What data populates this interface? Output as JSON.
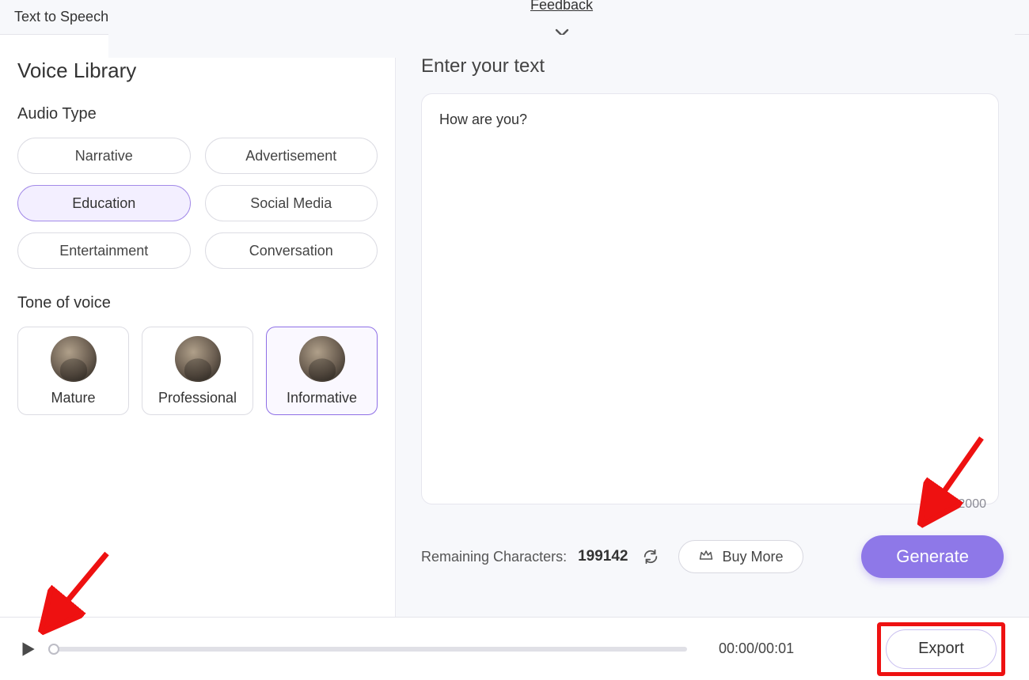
{
  "header": {
    "title": "Text to Speech",
    "feedback": "Feedback"
  },
  "left": {
    "library_title": "Voice Library",
    "audio_type_label": "Audio Type",
    "audio_types": [
      "Narrative",
      "Advertisement",
      "Education",
      "Social Media",
      "Entertainment",
      "Conversation"
    ],
    "audio_type_selected": "Education",
    "tone_label": "Tone of voice",
    "tones": [
      "Mature",
      "Professional",
      "Informative"
    ],
    "tone_selected": "Informative"
  },
  "right": {
    "enter_text_label": "Enter your text",
    "text_value": "How are you?",
    "char_counter": "12/2000",
    "remaining_label": "Remaining Characters:",
    "remaining_value": "199142",
    "buy_more_label": "Buy More",
    "generate_label": "Generate"
  },
  "player": {
    "time": "00:00/00:01",
    "export_label": "Export"
  }
}
